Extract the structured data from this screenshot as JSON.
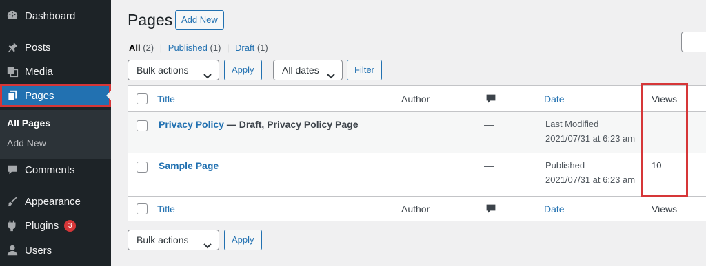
{
  "sidebar": {
    "items": [
      {
        "label": "Dashboard",
        "icon": "dashboard-icon"
      },
      {
        "label": "Posts",
        "icon": "pin-icon"
      },
      {
        "label": "Media",
        "icon": "media-icon"
      },
      {
        "label": "Pages",
        "icon": "pages-icon"
      },
      {
        "label": "Comments",
        "icon": "comment-icon"
      },
      {
        "label": "Appearance",
        "icon": "brush-icon"
      },
      {
        "label": "Plugins",
        "icon": "plug-icon",
        "badge": "3"
      },
      {
        "label": "Users",
        "icon": "user-icon"
      }
    ],
    "submenu": [
      "All Pages",
      "Add New"
    ]
  },
  "header": {
    "title": "Pages",
    "add_new": "Add New"
  },
  "views": {
    "all": "All",
    "all_count": "(2)",
    "published": "Published",
    "published_count": "(1)",
    "draft": "Draft",
    "draft_count": "(1)",
    "separator": "|"
  },
  "filters": {
    "bulk_actions": "Bulk actions",
    "apply": "Apply",
    "all_dates": "All dates",
    "filter": "Filter"
  },
  "table": {
    "columns": {
      "title": "Title",
      "author": "Author",
      "date": "Date",
      "views": "Views"
    },
    "rows": [
      {
        "title": "Privacy Policy",
        "state": " — Draft, Privacy Policy Page",
        "comments": "—",
        "date_status": "Last Modified",
        "date": "2021/07/31 at 6:23 am",
        "views": ""
      },
      {
        "title": "Sample Page",
        "state": "",
        "comments": "—",
        "date_status": "Published",
        "date": "2021/07/31 at 6:23 am",
        "views": "10"
      }
    ]
  },
  "bottom": {
    "bulk_actions": "Bulk actions",
    "apply": "Apply"
  },
  "colors": {
    "sidebar_bg": "#1d2327",
    "accent": "#2271b1",
    "highlight": "#d63638"
  }
}
